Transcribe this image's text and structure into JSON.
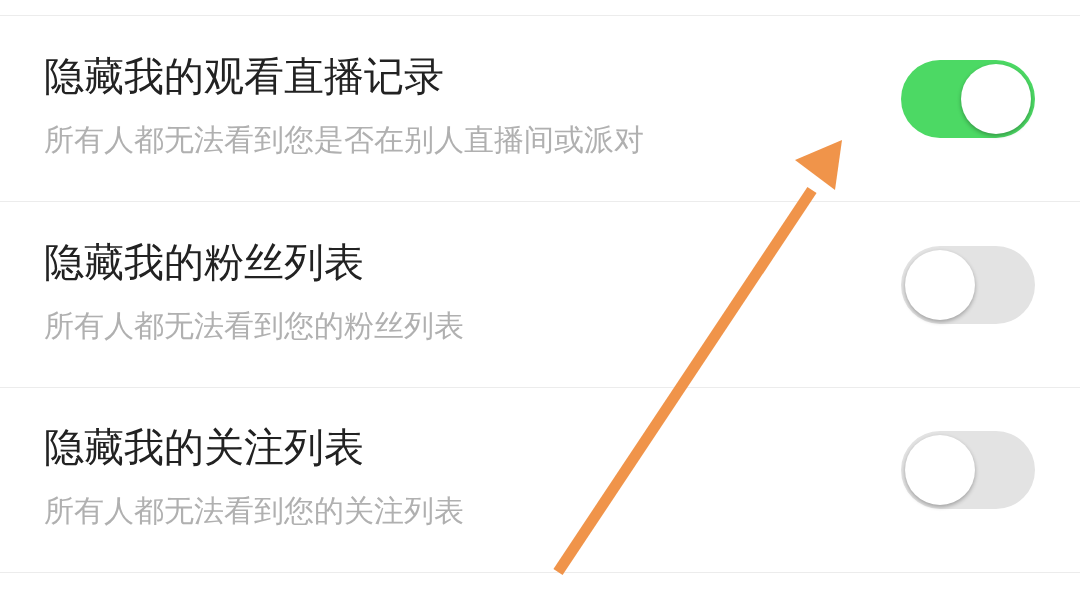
{
  "settings": [
    {
      "title": "隐藏我的观看直播记录",
      "subtitle": "所有人都无法看到您是否在别人直播间或派对",
      "on": true
    },
    {
      "title": "隐藏我的粉丝列表",
      "subtitle": "所有人都无法看到您的粉丝列表",
      "on": false
    },
    {
      "title": "隐藏我的关注列表",
      "subtitle": "所有人都无法看到您的关注列表",
      "on": false
    }
  ]
}
